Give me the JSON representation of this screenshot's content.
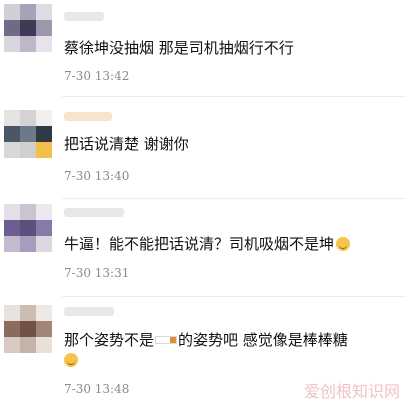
{
  "comments": [
    {
      "text": "蔡徐坤没抽烟 那是司机抽烟行不行",
      "time": "7-30 13:42"
    },
    {
      "text": "把话说清楚 谢谢你",
      "time": "7-30 13:40"
    },
    {
      "text": "牛逼！能不能把话说清？司机吸烟不是坤",
      "time": "7-30 13:31"
    },
    {
      "text_before": "那个姿势不是",
      "text_after": "的姿势吧 感觉像是棒棒糖",
      "time": "7-30 13:48"
    }
  ],
  "icons": {
    "emoji": "smile-emoji-icon",
    "cigarette": "cigarette-icon"
  },
  "watermark": {
    "text": "爱创根知识网"
  },
  "colors": {
    "time": "#8a8a8a",
    "separator": "#ededed",
    "watermark": "#f0c0c0"
  }
}
